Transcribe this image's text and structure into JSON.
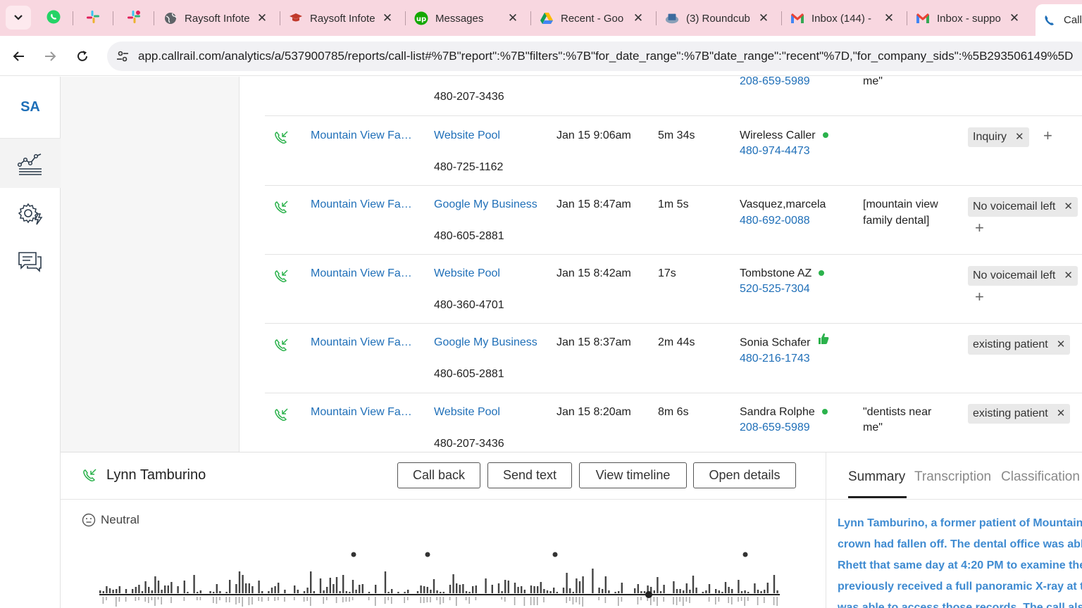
{
  "browser": {
    "tabs": [
      {
        "title": "",
        "icon": "whatsapp-icon"
      },
      {
        "title": "",
        "icon": "slack-icon"
      },
      {
        "title": "",
        "icon": "slack-icon"
      },
      {
        "title": "Raysoft Infote",
        "icon": "globe-icon"
      },
      {
        "title": "Raysoft Infote",
        "icon": "graduation-cap-icon"
      },
      {
        "title": "Messages",
        "icon": "upwork-icon"
      },
      {
        "title": "Recent - Goo",
        "icon": "google-drive-icon"
      },
      {
        "title": "(3) Roundcub",
        "icon": "roundcube-icon"
      },
      {
        "title": "Inbox (144) -",
        "icon": "gmail-icon"
      },
      {
        "title": "Inbox - suppo",
        "icon": "gmail-icon"
      },
      {
        "title": "Call",
        "icon": "callrail-icon"
      }
    ],
    "url": "app.callrail.com/analytics/a/537900785/reports/call-list#%7B\"report\":%7B\"filters\":%7B\"for_date_range\":%7B\"date_range\":\"recent\"%7D,\"for_company_sids\":%5B293506149%5D"
  },
  "leftnav": {
    "account_initials": "SA",
    "items": [
      "analytics-icon",
      "settings-bolt-icon",
      "messages-icon"
    ]
  },
  "calls": {
    "partial_top": {
      "tracking_number": "480-207-3436",
      "customer_phone": "208-659-5989",
      "keyword": "me\""
    },
    "rows": [
      {
        "company": "Mountain View Fa…",
        "source": "Website Pool",
        "tracking_number": "480-725-1162",
        "date": "Jan 15 9:06am",
        "duration": "5m 34s",
        "customer": "Wireless Caller",
        "customer_phone": "480-974-4473",
        "keyword": "",
        "tags": [
          "Inquiry"
        ],
        "indicator": "dot",
        "plus_inline": true
      },
      {
        "company": "Mountain View Fa…",
        "source": "Google My Business",
        "tracking_number": "480-605-2881",
        "date": "Jan 15 8:47am",
        "duration": "1m 5s",
        "customer": "Vasquez,marcela",
        "customer_phone": "480-692-0088",
        "keyword_line1": "[mountain view",
        "keyword_line2": "family dental]",
        "tags": [
          "No voicemail left"
        ],
        "indicator": "none",
        "plus_inline": false
      },
      {
        "company": "Mountain View Fa…",
        "source": "Website Pool",
        "tracking_number": "480-360-4701",
        "date": "Jan 15 8:42am",
        "duration": "17s",
        "customer": "Tombstone AZ",
        "customer_phone": "520-525-7304",
        "keyword": "",
        "tags": [
          "No voicemail left"
        ],
        "indicator": "dot",
        "plus_inline": false
      },
      {
        "company": "Mountain View Fa…",
        "source": "Google My Business",
        "tracking_number": "480-605-2881",
        "date": "Jan 15 8:37am",
        "duration": "2m 44s",
        "customer": "Sonia Schafer",
        "customer_phone": "480-216-1743",
        "keyword": "",
        "tags": [
          "existing patient"
        ],
        "indicator": "thumbs-up",
        "plus_inline": false
      },
      {
        "company": "Mountain View Fa…",
        "source": "Website Pool",
        "tracking_number": "480-207-3436",
        "date": "Jan 15 8:20am",
        "duration": "8m 6s",
        "customer": "Sandra Rolphe",
        "customer_phone": "208-659-5989",
        "keyword_line1": "\"dentists near",
        "keyword_line2": "me\"",
        "tags": [
          "existing patient"
        ],
        "indicator": "dot",
        "plus_inline": false
      }
    ]
  },
  "detail": {
    "caller_name": "Lynn Tamburino",
    "buttons": {
      "call_back": "Call back",
      "send_text": "Send text",
      "view_timeline": "View timeline",
      "open_details": "Open details"
    },
    "sentiment": "Neutral",
    "tabs": {
      "summary": "Summary",
      "transcription": "Transcription",
      "classification": "Classification"
    },
    "summary_lines": [
      "Lynn Tamburino, a former patient of Mountain",
      "crown had fallen off. The dental office was able",
      "Rhett that same day at 4:20 PM to examine the",
      "previously received a full panoramic X-ray at th",
      "was able to access those records. The call also"
    ]
  },
  "colors": {
    "link": "#1f6fb8",
    "accent_summary": "#3f8bd1",
    "status_green": "#2bb24c",
    "tab_strip": "#f8d7e0"
  }
}
